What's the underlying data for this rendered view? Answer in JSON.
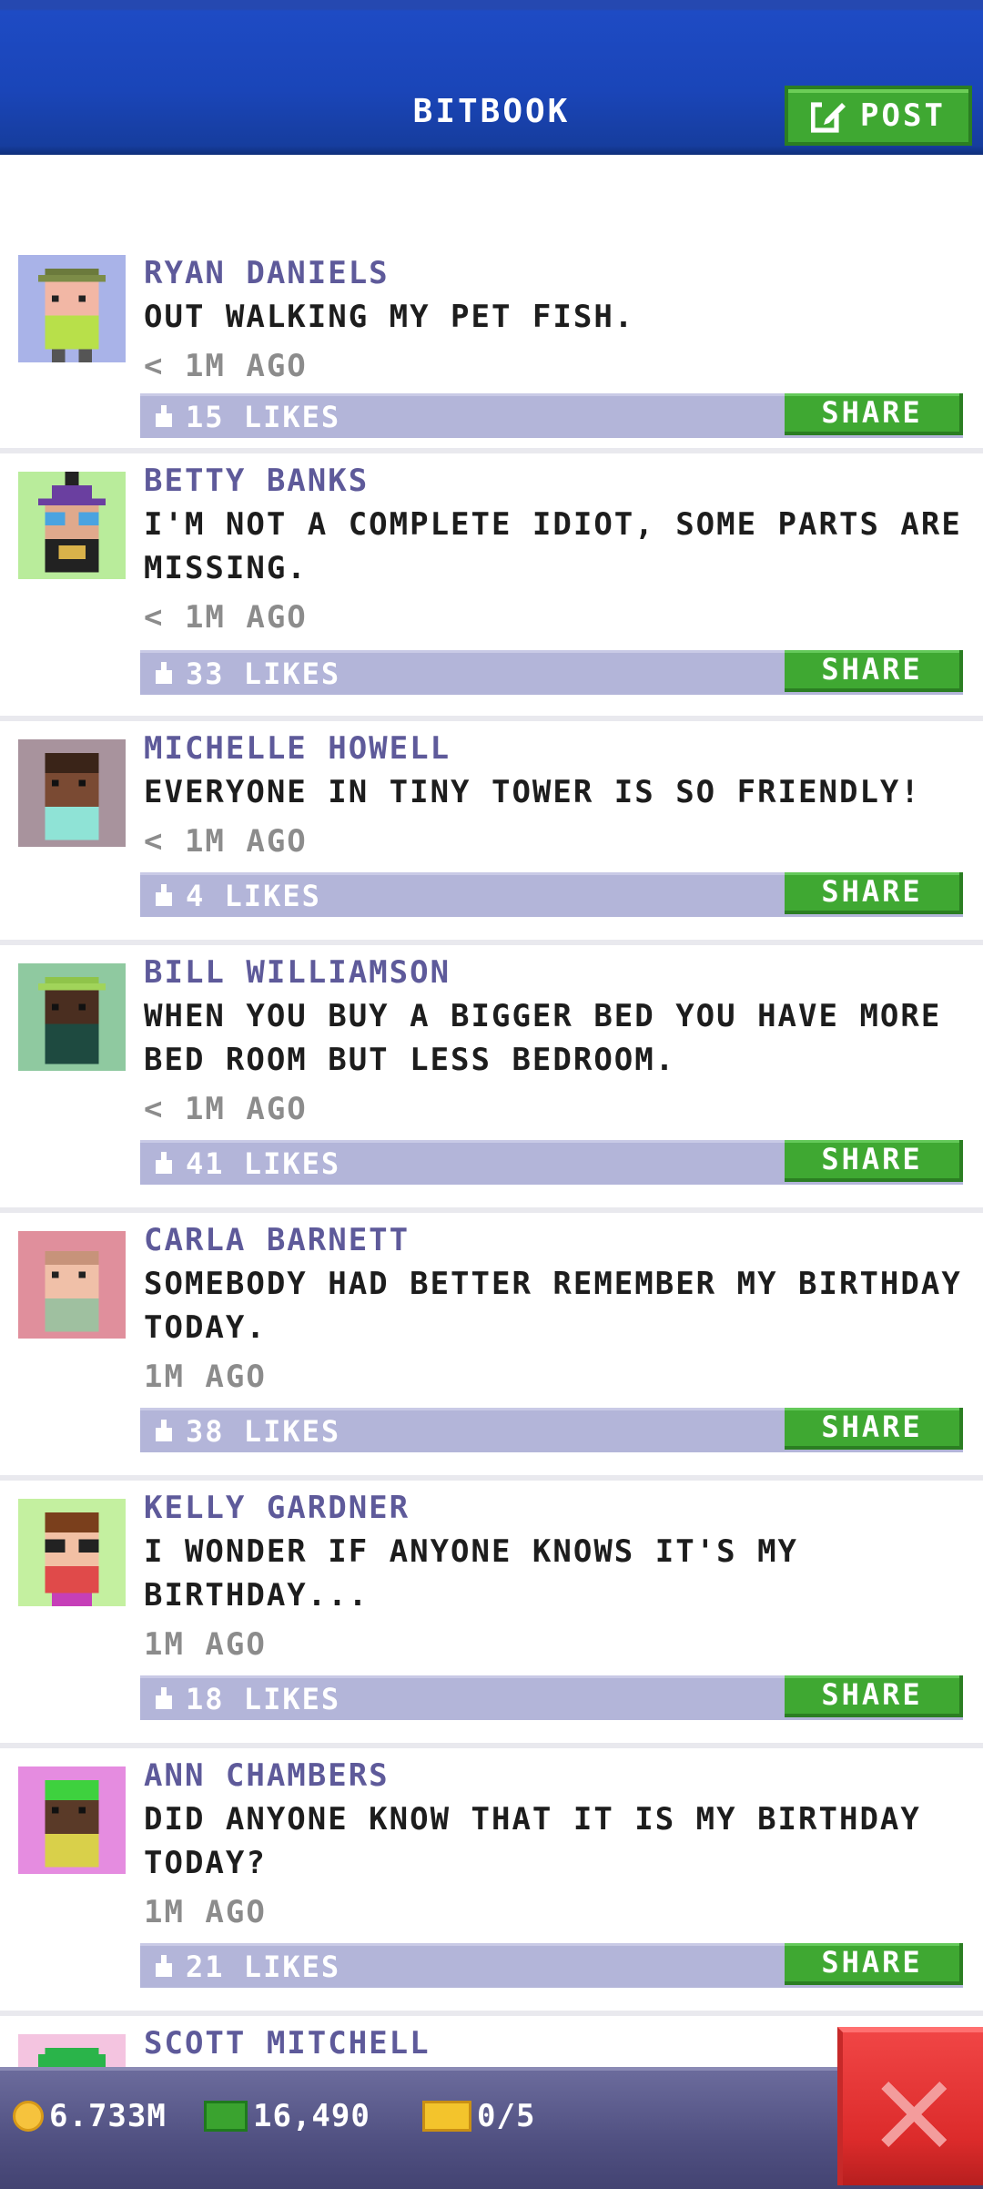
{
  "header": {
    "title": "BITBOOK",
    "post_label": "POST"
  },
  "posts": [
    {
      "author": "RYAN DANIELS",
      "text": "OUT WALKING MY PET FISH.",
      "time": "< 1M AGO",
      "likes": "15 LIKES",
      "share": "SHARE"
    },
    {
      "author": "BETTY BANKS",
      "text": "I'M NOT A COMPLETE IDIOT, SOME PARTS ARE MISSING.",
      "time": "< 1M AGO",
      "likes": "33 LIKES",
      "share": "SHARE"
    },
    {
      "author": "MICHELLE HOWELL",
      "text": "EVERYONE IN TINY TOWER IS SO FRIENDLY!",
      "time": "< 1M AGO",
      "likes": "4 LIKES",
      "share": "SHARE"
    },
    {
      "author": "BILL WILLIAMSON",
      "text": "WHEN YOU BUY A BIGGER BED YOU HAVE MORE BED ROOM BUT LESS BEDROOM.",
      "time": "< 1M AGO",
      "likes": "41 LIKES",
      "share": "SHARE"
    },
    {
      "author": "CARLA BARNETT",
      "text": "SOMEBODY HAD BETTER REMEMBER MY BIRTHDAY TODAY.",
      "time": "1M AGO",
      "likes": "38 LIKES",
      "share": "SHARE"
    },
    {
      "author": "KELLY GARDNER",
      "text": "I WONDER IF ANYONE KNOWS IT'S MY BIRTHDAY...",
      "time": "1M AGO",
      "likes": "18 LIKES",
      "share": "SHARE"
    },
    {
      "author": "ANN CHAMBERS",
      "text": "DID ANYONE KNOW THAT IT IS MY BIRTHDAY TODAY?",
      "time": "1M AGO",
      "likes": "21 LIKES",
      "share": "SHARE"
    },
    {
      "author": "SCOTT MITCHELL"
    }
  ],
  "footer": {
    "coins": "6.733M",
    "bux": "16,490",
    "tickets": "0/5"
  },
  "colors": {
    "header": "#1a45b8",
    "accent_green": "#3fa832",
    "likes_bar": "#b3b5d9",
    "author": "#5e5a9a",
    "close_red": "#dc2b2b"
  },
  "icons": {
    "post": "edit-icon",
    "likes": "thumb-icon",
    "coins": "coin-icon",
    "bux": "bux-icon",
    "tickets": "ticket-icon",
    "close": "close-icon"
  }
}
